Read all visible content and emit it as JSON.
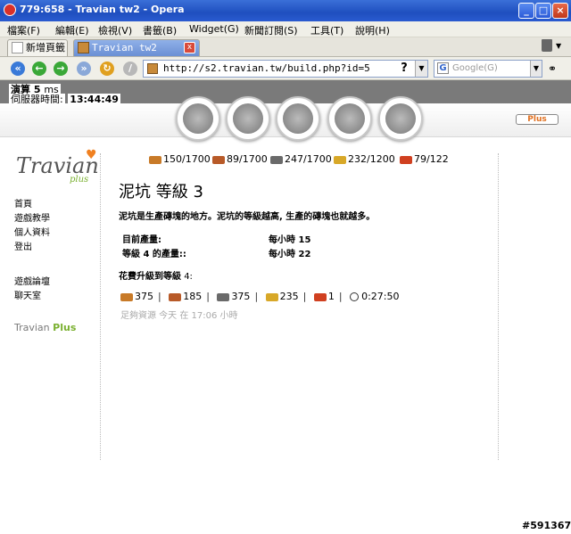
{
  "window": {
    "title": "779:658 - Travian tw2 - Opera",
    "buttons": [
      "_",
      "□",
      "×"
    ]
  },
  "menu": [
    "檔案(F)",
    "編輯(E)",
    "檢視(V)",
    "書籤(B)",
    "Widget(G)",
    "新聞訂閱(S)",
    "工具(T)",
    "說明(H)"
  ],
  "tabs": [
    {
      "label": "新增頁籤"
    },
    {
      "label": "Travian tw2",
      "close": "x"
    }
  ],
  "toolbar": {
    "address": "http://s2.travian.tw/build.php?id=5",
    "help": "?",
    "search_placeholder": "Google(G)"
  },
  "header": {
    "calc_label": "演算",
    "calc_value": "5",
    "calc_unit": "ms",
    "time_label": "伺服器時間:",
    "time_value": "13:44:49",
    "plus_button": "Plus"
  },
  "nav_icons": [
    "village-overview-icon",
    "village-center-icon",
    "map-icon",
    "statistics-icon",
    "reports-icon"
  ],
  "sidebar": {
    "logo_text": "Travian",
    "logo_sub": "plus",
    "items": [
      "首頁",
      "遊戲教學",
      "個人資料",
      "登出"
    ],
    "items2": [
      "遊戲論壇",
      "聊天室"
    ],
    "travian_plus_a": "Travian",
    "travian_plus_b": "Plus"
  },
  "resources": [
    {
      "icon": "wood-icon",
      "value": "150/1700"
    },
    {
      "icon": "clay-icon",
      "value": "89/1700"
    },
    {
      "icon": "iron-icon",
      "value": "247/1700"
    },
    {
      "icon": "crop-icon",
      "value": "232/1200"
    },
    {
      "icon": "consumption-icon",
      "value": "79/122"
    }
  ],
  "building": {
    "title": "泥坑 等級 3",
    "description": "泥坑是生產磚塊的地方。泥坑的等級越高, 生產的磚塊也就越多。",
    "current_label": "目前產量:",
    "current_value": "每小時 15",
    "next_label": "等級 4 的產量::",
    "next_value": "每小時 22",
    "upgrade_label": "花費升級到等級",
    "upgrade_level": "4:",
    "costs": [
      "375",
      "185",
      "375",
      "235",
      "1"
    ],
    "duration": "0:27:50",
    "enough_text": "足夠資源 今天 在 17:06 小時"
  },
  "watermark": "#591367"
}
